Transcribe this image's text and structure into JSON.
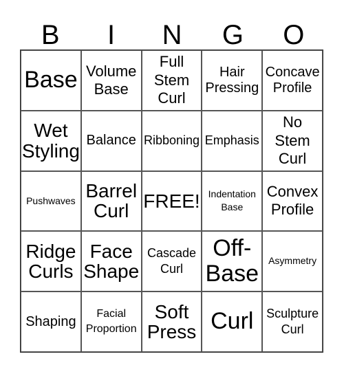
{
  "header": [
    "B",
    "I",
    "N",
    "G",
    "O"
  ],
  "cells": [
    {
      "text": "Base",
      "size": "s-xl"
    },
    {
      "text": "Volume Base",
      "size": "s-m"
    },
    {
      "text": "Full Stem Curl",
      "size": "s-m"
    },
    {
      "text": "Hair Pressing",
      "size": "s-ms"
    },
    {
      "text": "Concave Profile",
      "size": "s-ms"
    },
    {
      "text": "Wet Styling",
      "size": "s-l"
    },
    {
      "text": "Balance",
      "size": "s-ms"
    },
    {
      "text": "Ribboning",
      "size": "s-s"
    },
    {
      "text": "Emphasis",
      "size": "s-s"
    },
    {
      "text": "No Stem Curl",
      "size": "s-m"
    },
    {
      "text": "Pushwaves",
      "size": "s-xxs"
    },
    {
      "text": "Barrel Curl",
      "size": "s-l"
    },
    {
      "text": "FREE!",
      "size": "s-l"
    },
    {
      "text": "Indentation Base",
      "size": "s-xxs"
    },
    {
      "text": "Convex Profile",
      "size": "s-m"
    },
    {
      "text": "Ridge Curls",
      "size": "s-l"
    },
    {
      "text": "Face Shape",
      "size": "s-l"
    },
    {
      "text": "Cascade Curl",
      "size": "s-s"
    },
    {
      "text": "Off-Base",
      "size": "s-xl"
    },
    {
      "text": "Asymmetry",
      "size": "s-xxs"
    },
    {
      "text": "Shaping",
      "size": "s-ms"
    },
    {
      "text": "Facial Proportion",
      "size": "s-xs"
    },
    {
      "text": "Soft Press",
      "size": "s-l"
    },
    {
      "text": "Curl",
      "size": "s-xl"
    },
    {
      "text": "Sculpture Curl",
      "size": "s-s"
    }
  ]
}
